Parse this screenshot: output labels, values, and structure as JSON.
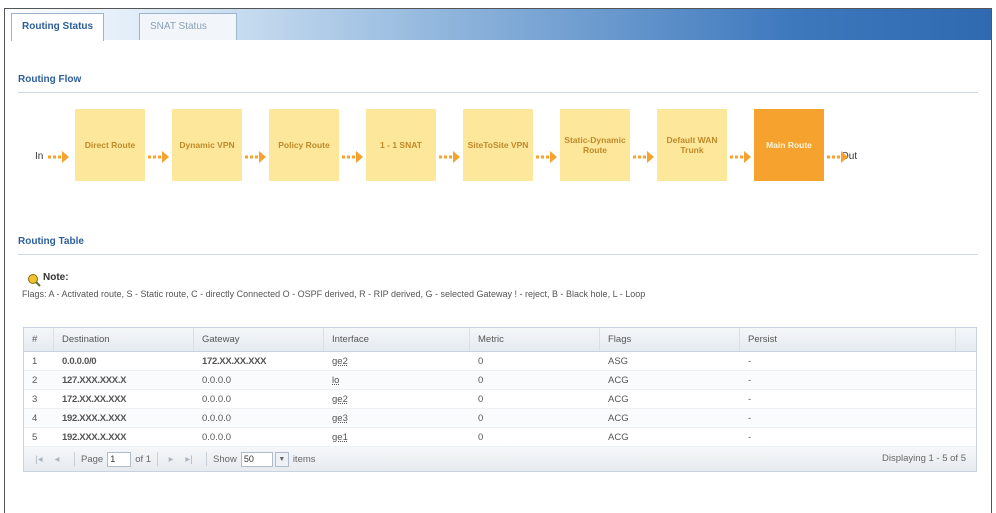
{
  "tabs": [
    {
      "label": "Routing Status",
      "active": true
    },
    {
      "label": "SNAT Status",
      "active": false
    }
  ],
  "routing_flow": {
    "title": "Routing Flow",
    "in_label": "In",
    "out_label": "Out",
    "steps": [
      {
        "label": "Direct Route"
      },
      {
        "label": "Dynamic VPN"
      },
      {
        "label": "Policy Route"
      },
      {
        "label": "1 - 1 SNAT"
      },
      {
        "label": "SiteToSite VPN"
      },
      {
        "label": "Static-Dynamic Route"
      },
      {
        "label": "Default WAN Trunk"
      },
      {
        "label": "Main Route",
        "selected": true
      }
    ],
    "colors": {
      "step": "#fde79a",
      "selected": "#f5a22f",
      "arrow": "#f5a22f"
    }
  },
  "routing_table": {
    "title": "Routing Table",
    "note_label": "Note:",
    "note_text": "Flags: A - Activated route, S - Static route, C - directly Connected O - OSPF derived, R - RIP derived, G - selected Gateway ! - reject, B - Black hole, L - Loop",
    "columns": [
      "#",
      "Destination",
      "Gateway",
      "Interface",
      "Metric",
      "Flags",
      "Persist"
    ],
    "rows": [
      {
        "num": "1",
        "destination": "0.0.0.0/0",
        "gateway": "172.XX.XX.XXX",
        "interface": "ge2",
        "metric": "0",
        "flags": "ASG",
        "persist": "-"
      },
      {
        "num": "2",
        "destination": "127.XXX.XXX.X",
        "gateway": "0.0.0.0",
        "interface": "lo",
        "metric": "0",
        "flags": "ACG",
        "persist": "-"
      },
      {
        "num": "3",
        "destination": "172.XX.XX.XXX",
        "gateway": "0.0.0.0",
        "interface": "ge2",
        "metric": "0",
        "flags": "ACG",
        "persist": "-"
      },
      {
        "num": "4",
        "destination": "192.XXX.X.XXX",
        "gateway": "0.0.0.0",
        "interface": "ge3",
        "metric": "0",
        "flags": "ACG",
        "persist": "-"
      },
      {
        "num": "5",
        "destination": "192.XXX.X.XXX",
        "gateway": "0.0.0.0",
        "interface": "ge1",
        "metric": "0",
        "flags": "ACG",
        "persist": "-"
      }
    ],
    "pager": {
      "page_label": "Page",
      "page_value": "1",
      "of_label": "of 1",
      "show_label": "Show",
      "show_value": "50",
      "items_label": "items",
      "display_text": "Displaying 1 - 5 of 5"
    }
  }
}
